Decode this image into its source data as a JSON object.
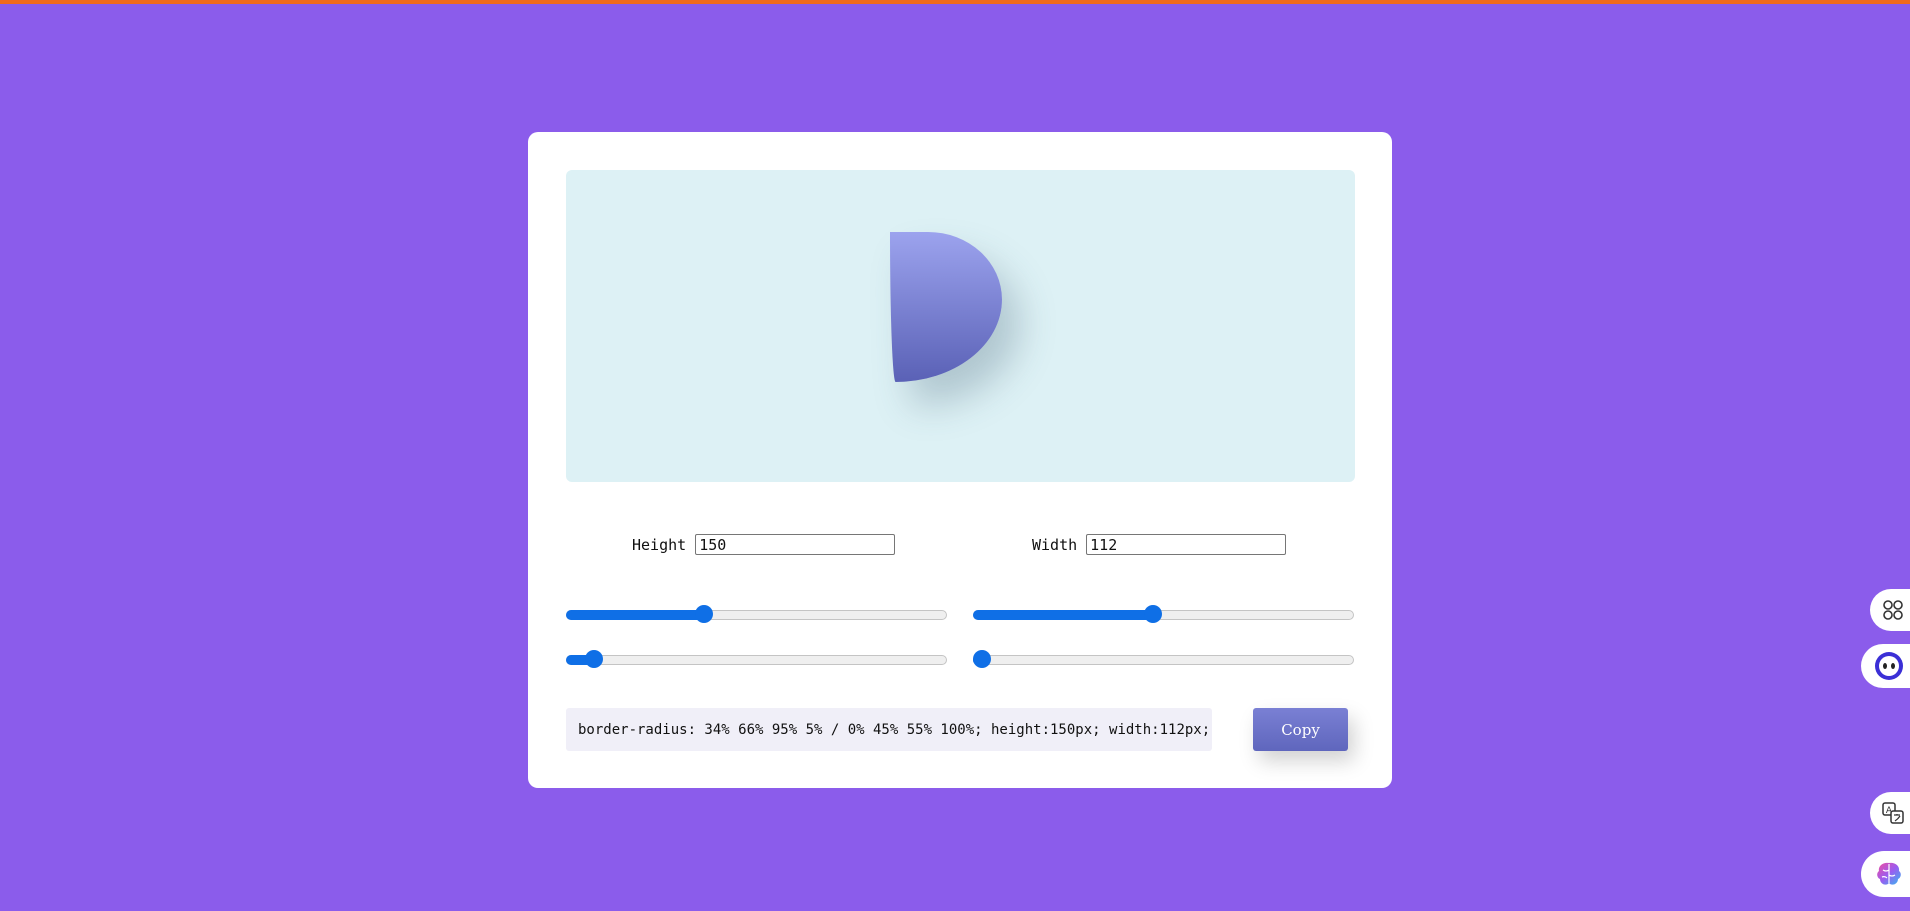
{
  "preview": {
    "shape_gradient": [
      "#9ca3ee",
      "#5a61b6"
    ],
    "border_radius": "34% 66% 95% 5% / 0% 45% 55% 100%"
  },
  "height_field": {
    "label": "Height",
    "value": "150"
  },
  "width_field": {
    "label": "Width",
    "value": "112"
  },
  "sliders": [
    {
      "name": "slider-top-left",
      "value": 34
    },
    {
      "name": "slider-top-right",
      "value": 45
    },
    {
      "name": "slider-bottom-left",
      "value": 5
    },
    {
      "name": "slider-bottom-right",
      "value": 0
    }
  ],
  "css_output": "border-radius: 34% 66% 95% 5% / 0% 45% 55% 100%; height:150px; width:112px;",
  "copy_button": {
    "label": "Copy"
  },
  "colors": {
    "page_background": "#8b5ceb",
    "top_bar": "#f06a1d",
    "preview_background": "#ddf1f5",
    "slider_accent": "#0f6fe6",
    "button": "#6a71c6"
  },
  "floating_icons": [
    "apps-icon",
    "bot-icon",
    "translate-icon",
    "brain-icon"
  ]
}
